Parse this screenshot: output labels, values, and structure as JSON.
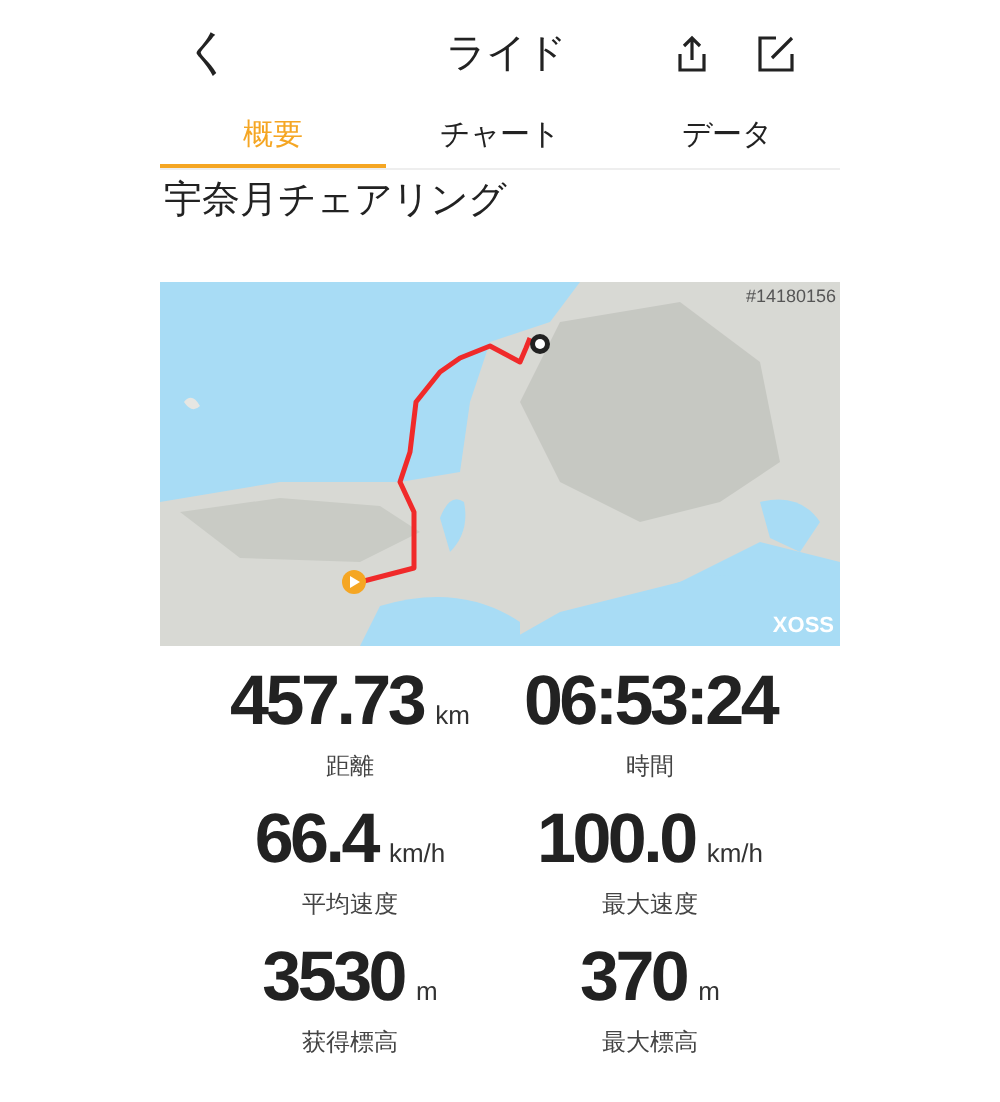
{
  "header": {
    "back": "く",
    "title": "ライド"
  },
  "tabs": [
    {
      "label": "概要",
      "selected": true
    },
    {
      "label": "チャート",
      "selected": false
    },
    {
      "label": "データ",
      "selected": false
    }
  ],
  "activity_title": "宇奈月チェアリング",
  "map": {
    "kind": "picture",
    "id_label": "#14180156",
    "brand": "XOSS"
  },
  "stats": [
    {
      "value": "457.73",
      "unit": "km",
      "label": "距離"
    },
    {
      "value": "06:53:24",
      "label": "時間"
    },
    {
      "value": "66.4",
      "unit": "km/h",
      "label": "平均速度"
    },
    {
      "value": "100.0",
      "unit": "km/h",
      "label": "最大速度"
    },
    {
      "value": "3530",
      "unit": "m",
      "label": "获得標高"
    },
    {
      "value": "370",
      "unit": "m",
      "label": "最大標高"
    }
  ]
}
